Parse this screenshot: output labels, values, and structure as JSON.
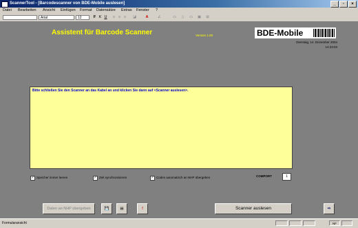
{
  "window": {
    "title": "ScannerTool - [Barcodescanner von BDE-Mobile auslesen]",
    "buttons": {
      "minimize": "_",
      "restore": "▫",
      "close": "×"
    }
  },
  "menubar": {
    "items": [
      "Datei",
      "Bearbeiten",
      "Ansicht",
      "Einfügen",
      "Format",
      "Datensätze",
      "Extras",
      "Fenster",
      "?"
    ]
  },
  "toolbar": {
    "font_name": "Arial",
    "font_size": "12",
    "bold": "F",
    "italic": "K",
    "underline": "U",
    "font_color": "A"
  },
  "header": {
    "title": "Assistent für Barcode Scanner",
    "version": "Version 1.00",
    "logo_text": "BDE-Mobile",
    "date": "Dienstag, 14. Dezember 2004",
    "time": "14:23:03"
  },
  "message": {
    "text": "Bitte schließen Sie den Scanner an das Kabel an und klicken Sie dann auf <Scanner auslesen>."
  },
  "options": {
    "opt1": "Speicher immer leeren",
    "opt2": "Zeit synchronisieren",
    "opt3": "Codes automatisch an NHP übergeben",
    "comport_label": "COMPORT",
    "comport_value": "1"
  },
  "buttons": {
    "transfer": "Daten an NHP übergeben",
    "save_icon": "💾",
    "print_icon": "▤",
    "warning_icon": "!",
    "read": "Scanner auslesen",
    "exit": "⇨"
  },
  "statusbar": {
    "text": "Formularansicht",
    "panel": "NF"
  },
  "colors": {
    "form_bg": "#808080",
    "header_text": "#ffff00",
    "message_bg": "#ffff99",
    "message_text": "#0000cc"
  }
}
